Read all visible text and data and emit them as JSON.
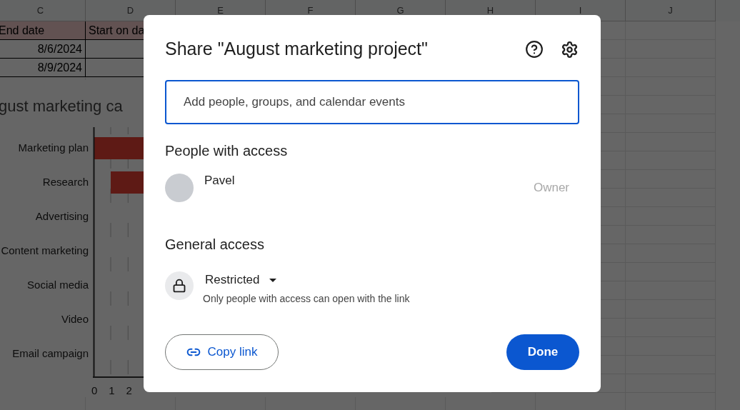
{
  "sheet": {
    "columns": [
      "C",
      "D",
      "E",
      "F",
      "G",
      "H",
      "I",
      "J"
    ],
    "header_row": [
      "End date",
      "Start on da"
    ],
    "rows": [
      [
        "8/6/2024"
      ],
      [
        "8/9/2024"
      ]
    ]
  },
  "chart": {
    "title": "gust marketing ca",
    "categories": [
      {
        "label": "Marketing plan",
        "has_bar": true
      },
      {
        "label": "Research",
        "has_bar": true
      },
      {
        "label": "Advertising",
        "has_bar": false
      },
      {
        "label": "Content marketing",
        "has_bar": false
      },
      {
        "label": "Social media",
        "has_bar": false
      },
      {
        "label": "Video",
        "has_bar": false
      },
      {
        "label": "Email campaign",
        "has_bar": false
      }
    ],
    "x_tick_labels": [
      "0",
      "1",
      "2"
    ]
  },
  "dialog": {
    "title": "Share \"August marketing project\"",
    "search": {
      "placeholder": "Add people, groups, and calendar events",
      "focused": true
    },
    "people_heading": "People with access",
    "people": [
      {
        "name": "Pavel",
        "role": "Owner"
      }
    ],
    "general_heading": "General access",
    "access": {
      "level": "Restricted",
      "description": "Only people with access can open with the link"
    },
    "buttons": [
      {
        "label": "Copy link",
        "kind": "outlined"
      },
      {
        "label": "Done",
        "kind": "filled"
      }
    ]
  }
}
